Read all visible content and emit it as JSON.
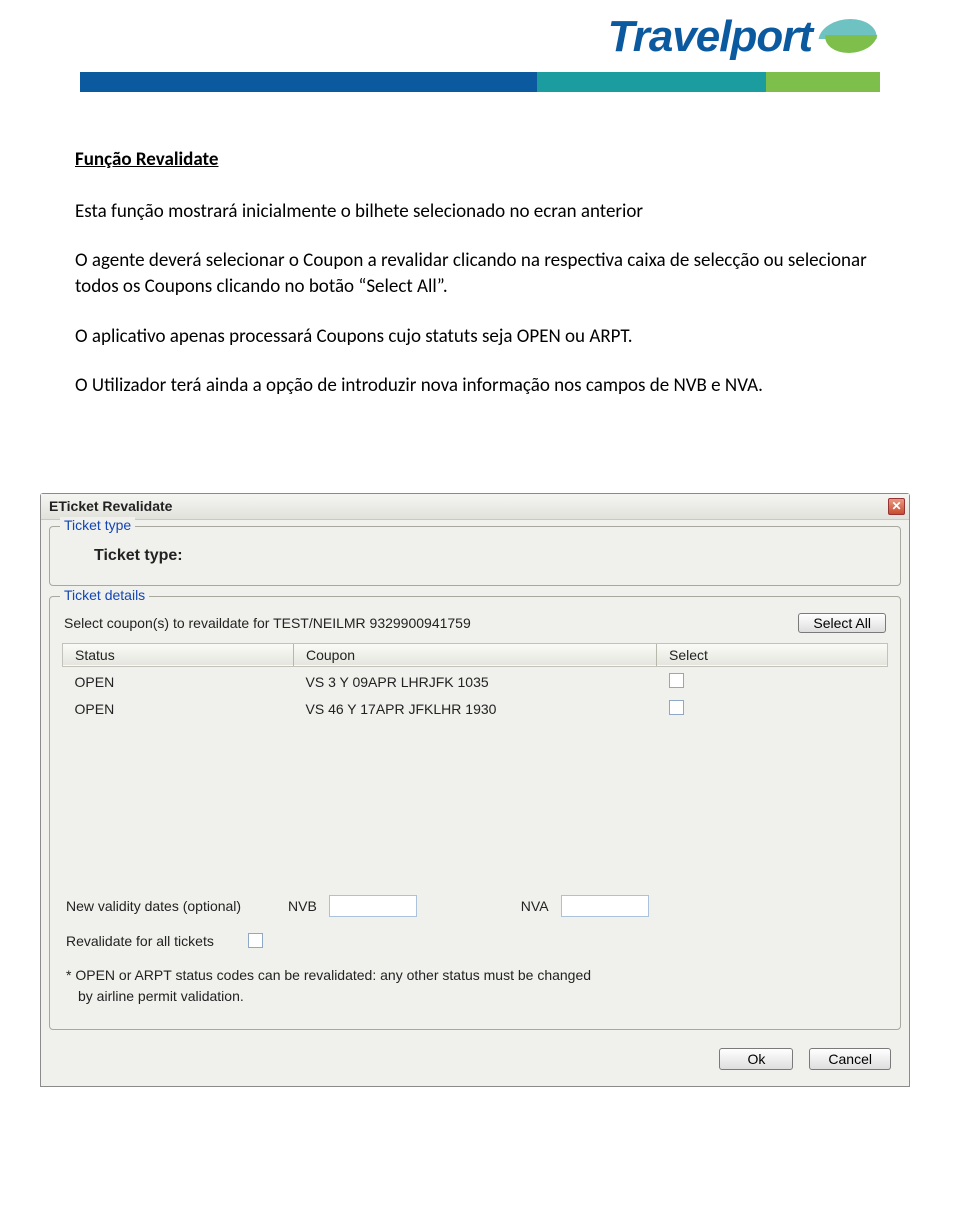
{
  "logo": {
    "text": "Travelport"
  },
  "article": {
    "title": "Função Revalidate",
    "p1": "Esta função mostrará inicialmente o bilhete selecionado no ecran anterior",
    "p2": "O agente deverá selecionar o Coupon a revalidar clicando na respectiva caixa de selecção ou selecionar todos os Coupons clicando no botão “Select All”.",
    "p3": "O aplicativo apenas processará Coupons cujo statuts seja OPEN ou ARPT.",
    "p4": "O Utilizador terá ainda a opção de introduzir nova informação nos campos de NVB e NVA."
  },
  "dialog": {
    "title": "ETicket Revalidate",
    "ticket_type": {
      "legend": "Ticket type",
      "label": "Ticket type:"
    },
    "details": {
      "legend": "Ticket details",
      "select_line": "Select coupon(s) to revaildate for TEST/NEILMR  9329900941759",
      "select_all": "Select All",
      "headers": {
        "status": "Status",
        "coupon": "Coupon",
        "select": "Select"
      },
      "rows": [
        {
          "status": "OPEN",
          "coupon": "VS 3 Y 09APR LHRJFK 1035"
        },
        {
          "status": "OPEN",
          "coupon": "VS 46 Y 17APR JFKLHR 1930"
        }
      ],
      "validity_label": "New validity dates (optional)",
      "nvb_label": "NVB",
      "nva_label": "NVA",
      "nvb_value": "",
      "nva_value": "",
      "revalidate_all_label": "Revalidate for all tickets",
      "note_line1": "* OPEN or ARPT status codes can be revalidated: any other status must be changed",
      "note_line2": "by airline permit validation."
    },
    "buttons": {
      "ok": "Ok",
      "cancel": "Cancel"
    }
  }
}
